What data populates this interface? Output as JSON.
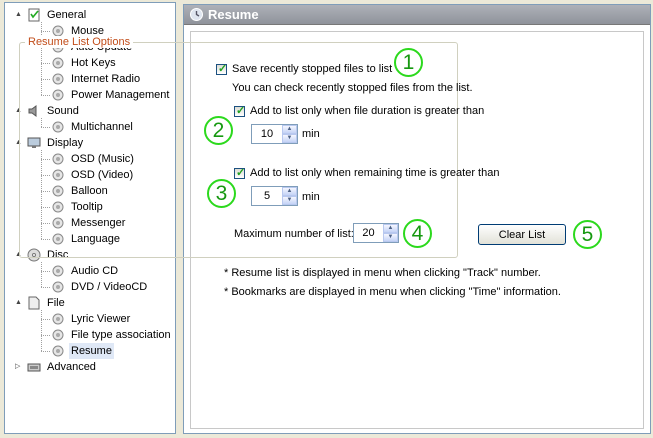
{
  "tree": [
    {
      "label": "General",
      "depth": 0,
      "icon": "settings-icon",
      "toggle": "minus"
    },
    {
      "label": "Mouse",
      "depth": 1,
      "icon": "mouse-icon"
    },
    {
      "label": "Auto Update",
      "depth": 1,
      "icon": "update-icon"
    },
    {
      "label": "Hot Keys",
      "depth": 1,
      "icon": "keyboard-icon"
    },
    {
      "label": "Internet Radio",
      "depth": 1,
      "icon": "radio-icon"
    },
    {
      "label": "Power Management",
      "depth": 1,
      "icon": "power-icon"
    },
    {
      "label": "Sound",
      "depth": 0,
      "icon": "speaker-icon",
      "toggle": "minus"
    },
    {
      "label": "Multichannel",
      "depth": 1,
      "icon": "multichannel-icon"
    },
    {
      "label": "Display",
      "depth": 0,
      "icon": "display-icon",
      "toggle": "minus"
    },
    {
      "label": "OSD (Music)",
      "depth": 1,
      "icon": "osd-music-icon"
    },
    {
      "label": "OSD (Video)",
      "depth": 1,
      "icon": "osd-video-icon"
    },
    {
      "label": "Balloon",
      "depth": 1,
      "icon": "balloon-icon"
    },
    {
      "label": "Tooltip",
      "depth": 1,
      "icon": "tooltip-icon"
    },
    {
      "label": "Messenger",
      "depth": 1,
      "icon": "messenger-icon"
    },
    {
      "label": "Language",
      "depth": 1,
      "icon": "language-icon"
    },
    {
      "label": "Disc",
      "depth": 0,
      "icon": "disc-icon",
      "toggle": "minus"
    },
    {
      "label": "Audio CD",
      "depth": 1,
      "icon": "audio-cd-icon"
    },
    {
      "label": "DVD / VideoCD",
      "depth": 1,
      "icon": "dvd-icon"
    },
    {
      "label": "File",
      "depth": 0,
      "icon": "file-icon",
      "toggle": "minus"
    },
    {
      "label": "Lyric Viewer",
      "depth": 1,
      "icon": "lyric-icon"
    },
    {
      "label": "File type association",
      "depth": 1,
      "icon": "association-icon"
    },
    {
      "label": "Resume",
      "depth": 1,
      "icon": "resume-icon",
      "selected": true
    },
    {
      "label": "Advanced",
      "depth": 0,
      "icon": "advanced-icon",
      "toggle": "plus"
    }
  ],
  "panel": {
    "title": "Resume",
    "group_title": "Resume List Options",
    "save_recent": {
      "label": "Save recently stopped files to list",
      "checked": true
    },
    "hint": "You can check recently stopped files from the list.",
    "duration": {
      "label": "Add to list only when file duration is greater than",
      "checked": true,
      "value": "10",
      "unit": "min"
    },
    "remaining": {
      "label": "Add to list only when remaining time is greater than",
      "checked": true,
      "value": "5",
      "unit": "min"
    },
    "max_label": "Maximum number of list:",
    "max_value": "20",
    "clear_label": "Clear List",
    "notes": [
      "* Resume list is displayed in menu when clicking \"Track\" number.",
      "* Bookmarks are displayed in menu when clicking \"Time\" information."
    ]
  },
  "callouts": [
    "1",
    "2",
    "3",
    "4",
    "5"
  ],
  "colors": {
    "accent_green": "#2cd91d",
    "group_title": "#c24d1a",
    "selected": "#dfe8f6"
  }
}
